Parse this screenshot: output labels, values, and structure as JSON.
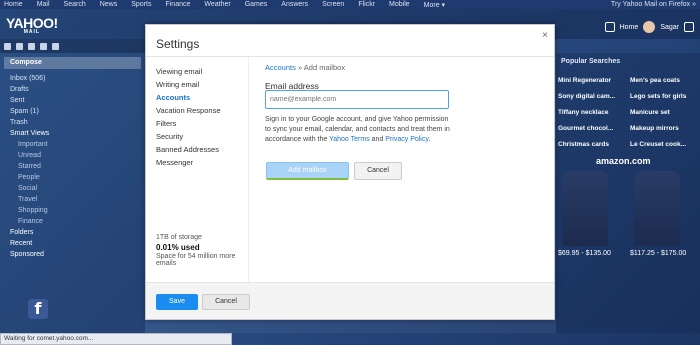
{
  "topnav": [
    "Home",
    "Mail",
    "Search",
    "News",
    "Sports",
    "Finance",
    "Weather",
    "Games",
    "Answers",
    "Screen",
    "Flickr",
    "Mobile",
    "More ▾"
  ],
  "topnav_promo": "Try Yahoo Mail on Firefox »",
  "header": {
    "logo": "YAHOO!",
    "logo_sub": "MAIL",
    "home": "Home",
    "user": "Sagar"
  },
  "sidebar": {
    "compose": "Compose",
    "items": [
      "Inbox (506)",
      "Drafts",
      "Sent",
      "Spam (1)",
      "Trash"
    ],
    "smart_views": "Smart Views",
    "smart_items": [
      "Important",
      "Unread",
      "Starred",
      "People",
      "Social",
      "Travel",
      "Shopping",
      "Finance"
    ],
    "folders": "Folders",
    "recent": "Recent",
    "sponsored": "Sponsored"
  },
  "ads": {
    "title": "Popular Searches",
    "rows": [
      [
        "Mini Regenerator",
        "Men's pea coats"
      ],
      [
        "Sony digital cam...",
        "Lego sets for girls"
      ],
      [
        "Tiffany necklace",
        "Manicure set"
      ],
      [
        "Gourmet chocol...",
        "Makeup mirrors"
      ],
      [
        "Christmas cards",
        "Le Creuset cook..."
      ]
    ],
    "amazon": "amazon.com",
    "price_left": "$69.95 - $135.00",
    "price_right": "$117.25 - $175.00"
  },
  "modal": {
    "title": "Settings",
    "close": "×",
    "nav": [
      "Viewing email",
      "Writing email",
      "Accounts",
      "Vacation Response",
      "Filters",
      "Security",
      "Banned Addresses",
      "Messenger"
    ],
    "active_nav": "Accounts",
    "breadcrumb": {
      "parent": "Accounts",
      "sep": "»",
      "current": "Add mailbox"
    },
    "email_label": "Email address",
    "email_placeholder": "name@example.com",
    "description": "Sign in to your Google account, and give Yahoo permission to sync your email, calendar, and contacts and treat them in accordance with the",
    "terms_link": "Yahoo Terms",
    "and": "and",
    "privacy_link": "Privacy Policy",
    "period": ".",
    "add_button": "Add mailbox",
    "cancel_button": "Cancel",
    "storage": {
      "total": "1TB of storage",
      "used": "0.01% used",
      "space": "Space for 54 million more emails"
    },
    "save": "Save",
    "cancel": "Cancel"
  },
  "status_bar": "Waiting for comet.yahoo.com..."
}
